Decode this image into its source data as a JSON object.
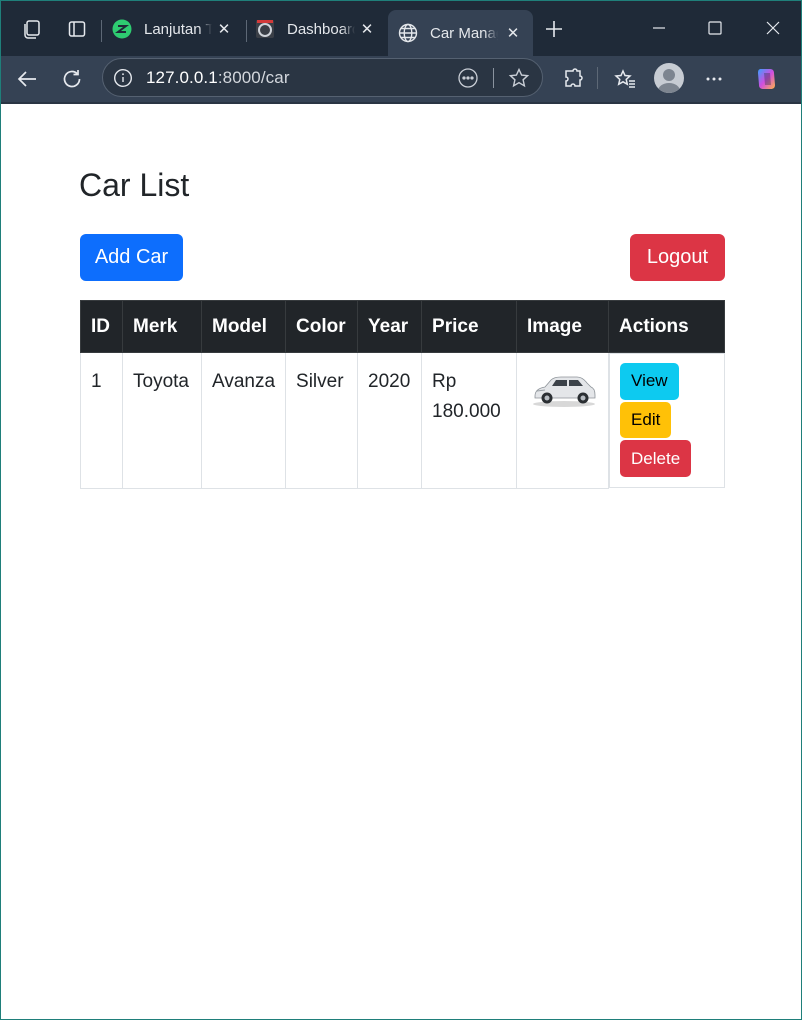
{
  "browser": {
    "tabs": [
      {
        "label": "Lanjutan Teknik",
        "active": false
      },
      {
        "label": "Dashboard",
        "active": false
      },
      {
        "label": "Car Management",
        "active": true
      }
    ],
    "url_host": "127.0.0.1",
    "url_rest": ":8000/car"
  },
  "page": {
    "title": "Car List",
    "add_label": "Add Car",
    "logout_label": "Logout"
  },
  "table": {
    "headers": [
      "ID",
      "Merk",
      "Model",
      "Color",
      "Year",
      "Price",
      "Image",
      "Actions"
    ],
    "rows": [
      {
        "id": "1",
        "merk": "Toyota",
        "model": "Avanza",
        "color": "Silver",
        "year": "2020",
        "price": "Rp 180.000"
      }
    ],
    "action_labels": {
      "view": "View",
      "edit": "Edit",
      "delete": "Delete"
    }
  },
  "colors": {
    "primary": "#0d6efd",
    "danger": "#dc3545",
    "info": "#0dcaf0",
    "warning": "#ffc107",
    "table_header": "#212529"
  }
}
